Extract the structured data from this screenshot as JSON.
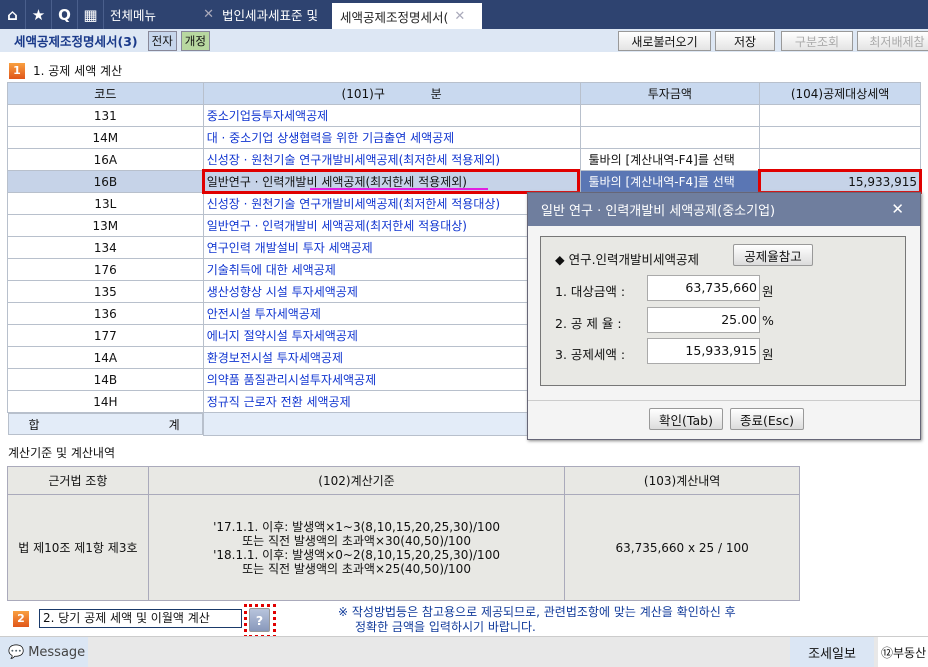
{
  "tabs": {
    "menu": "전체메뉴",
    "items": [
      {
        "label": "법인세과세표준 및"
      },
      {
        "label": "세액공제조정명세서("
      }
    ]
  },
  "toolbar": {
    "title": "세액공제조정명세서(3)",
    "badge1": "전자",
    "badge2": "개정",
    "reload": "새로불러오기",
    "save": "저장",
    "lookup": "구분조회",
    "minmax": "최저배제참"
  },
  "section1": {
    "num": "1",
    "label": "1. 공제 세액 계산"
  },
  "table": {
    "headers": [
      "코드",
      "(101)구            분",
      "투자금액",
      "(104)공제대상세액"
    ],
    "rows": [
      {
        "code": "131",
        "name": "중소기업등투자세액공제",
        "invest": "",
        "amount": ""
      },
      {
        "code": "14M",
        "name": "대 · 중소기업 상생협력을 위한 기금출연 세액공제",
        "invest": "",
        "amount": ""
      },
      {
        "code": "16A",
        "name": "신성장 · 원천기술 연구개발비세액공제(최저한세 적용제외)",
        "invest": "툴바의 [계산내역-F4]를 선택",
        "amount": ""
      },
      {
        "code": "16B",
        "name": "일반연구 · 인력개발비 세액공제(최저한세 적용제외)",
        "invest": "툴바의 [계산내역-F4]를 선택",
        "amount": "15,933,915"
      },
      {
        "code": "13L",
        "name": "신성장 · 원천기술 연구개발비세액공제(최저한세 적용대상)",
        "invest": "",
        "amount": ""
      },
      {
        "code": "13M",
        "name": "일반연구 · 인력개발비 세액공제(최저한세 적용대상)",
        "invest": "",
        "amount": ""
      },
      {
        "code": "134",
        "name": "연구인력 개발설비 투자 세액공제",
        "invest": "",
        "amount": ""
      },
      {
        "code": "176",
        "name": "기술취득에 대한 세액공제",
        "invest": "",
        "amount": ""
      },
      {
        "code": "135",
        "name": "생산성향상 시설 투자세액공제",
        "invest": "",
        "amount": ""
      },
      {
        "code": "136",
        "name": "안전시설 투자세액공제",
        "invest": "",
        "amount": ""
      },
      {
        "code": "177",
        "name": "에너지 절약시설 투자세액공제",
        "invest": "",
        "amount": ""
      },
      {
        "code": "14A",
        "name": "환경보전시설 투자세액공제",
        "invest": "",
        "amount": ""
      },
      {
        "code": "14B",
        "name": "의약품 품질관리시설투자세액공제",
        "invest": "",
        "amount": ""
      },
      {
        "code": "14H",
        "name": "정규직 근로자 전환 세액공제",
        "invest": "",
        "amount": ""
      }
    ],
    "sum_a": "합",
    "sum_b": "계"
  },
  "dialog": {
    "title": "일반 연구 · 인력개발비 세액공제(중소기업)",
    "heading": "◆ 연구.인력개발비세액공제",
    "rate_ref": "공제율참고",
    "fields": [
      {
        "label": "1. 대상금액  :",
        "value": "63,735,660",
        "unit": "원"
      },
      {
        "label": "2. 공 제 율  :",
        "value": "25.00",
        "unit": "%"
      },
      {
        "label": "3. 공제세액  :",
        "value": "15,933,915",
        "unit": "원"
      }
    ],
    "ok": "확인(Tab)",
    "close": "종료(Esc)"
  },
  "calc": {
    "title": "계산기준 및 계산내역",
    "headers": [
      "근거법 조항",
      "(102)계산기준",
      "(103)계산내역"
    ],
    "law": "법 제10조 제1항 제3호",
    "basis": [
      "'17.1.1. 이후: 발생액×1~3(8,10,15,20,25,30)/100",
      "또는 직전 발생액의 초과액×30(40,50)/100",
      "'18.1.1. 이후: 발생액×0~2(8,10,15,20,25,30)/100",
      "또는 직전 발생액의 초과액×25(40,50)/100"
    ],
    "detail": "63,735,660 x 25 / 100"
  },
  "section2": {
    "num": "2",
    "label": "2. 당기 공제 세액 및 이월액 계산",
    "help": "?",
    "note1": "※ 작성방법등은 참고용으로 제공되므로, 관련법조항에 맞는 계산을 확인하신 후",
    "note2": "정확한 금액을 입력하시기 바랍니다."
  },
  "status": {
    "message": "Message",
    "news": "조세일보",
    "realty": "⑫부동산"
  }
}
